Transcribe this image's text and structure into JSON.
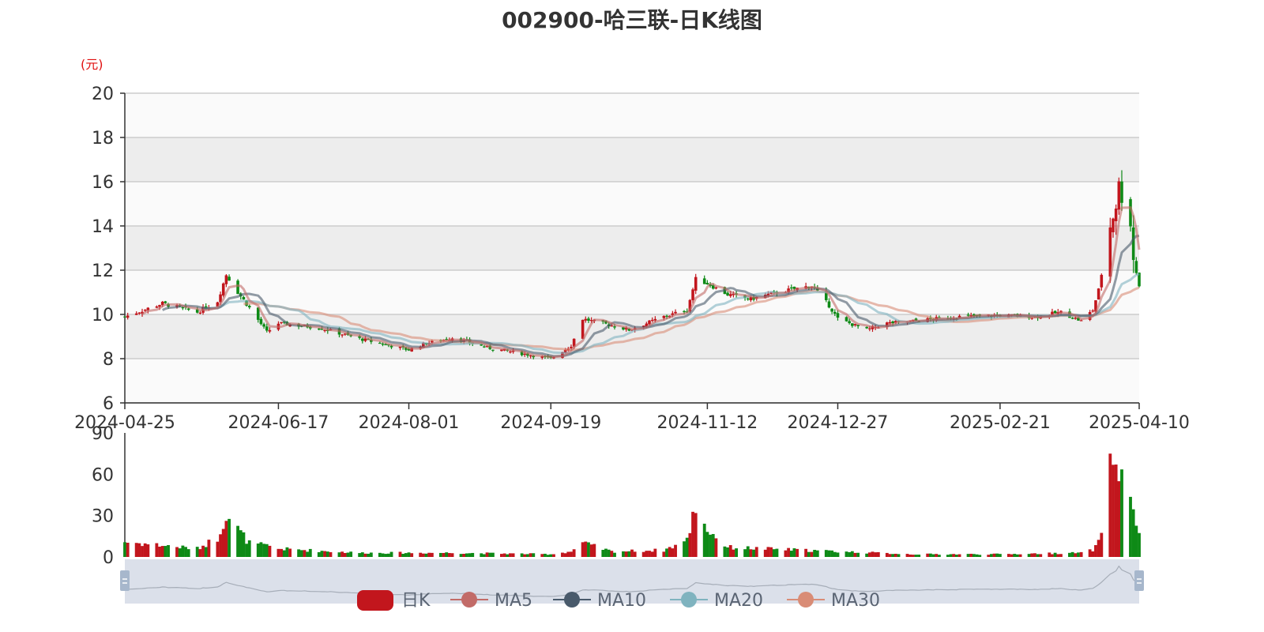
{
  "chart_data": {
    "type": "candlestick",
    "title": "002900-哈三联-日K线图",
    "y_unit": "(元)",
    "ylim": [
      6,
      20
    ],
    "y_ticks": [
      6,
      8,
      10,
      12,
      14,
      16,
      18,
      20
    ],
    "x_start": "2024-04-25",
    "x_end": "2025-04-10",
    "x_ticks": [
      "2024-04-25",
      "2024-06-17",
      "2024-08-01",
      "2024-09-19",
      "2024-11-12",
      "2024-12-27",
      "2025-02-21",
      "2025-04-10"
    ],
    "volume_ylim": [
      0,
      90
    ],
    "volume_ticks": [
      0,
      30,
      60,
      90
    ],
    "legend": [
      "日K",
      "MA5",
      "MA10",
      "MA20",
      "MA30"
    ],
    "price_anchors": [
      [
        "2024-04-25",
        9.9
      ],
      [
        "2024-05-08",
        10.5
      ],
      [
        "2024-05-20",
        10.1
      ],
      [
        "2024-05-27",
        10.6
      ],
      [
        "2024-05-30",
        11.8
      ],
      [
        "2024-06-03",
        11.0
      ],
      [
        "2024-06-07",
        10.3
      ],
      [
        "2024-06-13",
        9.2
      ],
      [
        "2024-06-17",
        9.6
      ],
      [
        "2024-07-01",
        9.4
      ],
      [
        "2024-07-15",
        8.9
      ],
      [
        "2024-08-01",
        8.4
      ],
      [
        "2024-08-07",
        8.7
      ],
      [
        "2024-08-16",
        8.95
      ],
      [
        "2024-08-28",
        8.5
      ],
      [
        "2024-09-06",
        8.3
      ],
      [
        "2024-09-19",
        8.0
      ],
      [
        "2024-09-26",
        8.6
      ],
      [
        "2024-09-30",
        9.8
      ],
      [
        "2024-10-10",
        9.5
      ],
      [
        "2024-10-16",
        9.3
      ],
      [
        "2024-10-28",
        9.9
      ],
      [
        "2024-11-05",
        10.2
      ],
      [
        "2024-11-08",
        11.6
      ],
      [
        "2024-11-12",
        11.4
      ],
      [
        "2024-11-19",
        10.9
      ],
      [
        "2024-11-27",
        10.7
      ],
      [
        "2024-12-06",
        11.0
      ],
      [
        "2024-12-18",
        11.3
      ],
      [
        "2024-12-24",
        10.4
      ],
      [
        "2024-12-27",
        9.8
      ],
      [
        "2025-01-06",
        9.3
      ],
      [
        "2025-01-13",
        9.6
      ],
      [
        "2025-01-22",
        9.7
      ],
      [
        "2025-02-07",
        9.9
      ],
      [
        "2025-02-21",
        9.95
      ],
      [
        "2025-03-05",
        9.9
      ],
      [
        "2025-03-14",
        10.1
      ],
      [
        "2025-03-21",
        9.7
      ],
      [
        "2025-03-25",
        10.2
      ],
      [
        "2025-03-27",
        11.1
      ],
      [
        "2025-03-31",
        14.0
      ],
      [
        "2025-04-02",
        15.0
      ],
      [
        "2025-04-03",
        15.8
      ],
      [
        "2025-04-07",
        14.2
      ],
      [
        "2025-04-08",
        12.5
      ],
      [
        "2025-04-09",
        11.9
      ],
      [
        "2025-04-10",
        11.3
      ]
    ],
    "volume_anchors": [
      [
        "2024-04-25",
        11
      ],
      [
        "2024-05-20",
        6
      ],
      [
        "2024-05-27",
        14
      ],
      [
        "2024-05-30",
        32
      ],
      [
        "2024-06-03",
        20
      ],
      [
        "2024-06-07",
        10
      ],
      [
        "2024-06-13",
        8
      ],
      [
        "2024-06-17",
        6
      ],
      [
        "2024-07-15",
        3
      ],
      [
        "2024-08-01",
        3
      ],
      [
        "2024-08-16",
        3
      ],
      [
        "2024-09-19",
        2
      ],
      [
        "2024-09-26",
        4
      ],
      [
        "2024-09-30",
        10
      ],
      [
        "2024-10-10",
        4
      ],
      [
        "2024-10-28",
        5
      ],
      [
        "2024-11-05",
        12
      ],
      [
        "2024-11-08",
        38
      ],
      [
        "2024-11-12",
        20
      ],
      [
        "2024-11-19",
        7
      ],
      [
        "2024-12-27",
        4
      ],
      [
        "2025-01-22",
        2
      ],
      [
        "2025-02-21",
        2
      ],
      [
        "2025-03-21",
        3
      ],
      [
        "2025-03-25",
        5
      ],
      [
        "2025-03-27",
        10
      ],
      [
        "2025-03-31",
        63
      ],
      [
        "2025-04-02",
        70
      ],
      [
        "2025-04-03",
        65
      ],
      [
        "2025-04-07",
        45
      ],
      [
        "2025-04-08",
        30
      ],
      [
        "2025-04-09",
        24
      ],
      [
        "2025-04-10",
        21
      ]
    ]
  },
  "colors": {
    "up": "#c2161d",
    "down": "#0e8a16",
    "ma5": "#c26b68",
    "ma10": "#495a6b",
    "ma20": "#7fb3bf",
    "ma30": "#d98c76",
    "grid": "#cccccc",
    "band": "#ededed",
    "slider_fill": "#d7dde8",
    "slider_handle": "#a7b7cc"
  }
}
